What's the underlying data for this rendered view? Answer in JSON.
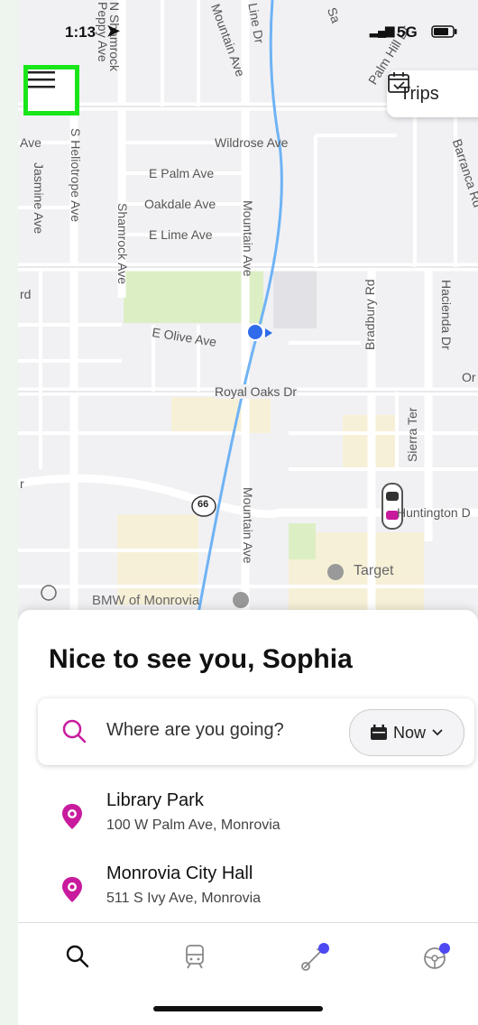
{
  "status": {
    "time": "1:13",
    "network": "5G"
  },
  "trips_label": "Trips",
  "map_labels": {
    "streets": [
      "Wildrose Ave",
      "E Palm Ave",
      "Oakdale Ave",
      "E Lime Ave",
      "E Olive Ave",
      "Royal Oaks Dr",
      "Mountain Ave",
      "Mountain Ave",
      "Shamrock Ave",
      "S Heliotrope Ave",
      "Jasmine Ave",
      "Bradbury Rd",
      "Hacienda Dr",
      "Sierra Ter",
      "Barranca Rd",
      "Palm Hill Dr",
      "Huntington D",
      "Peppy Ave",
      "N Shamrock",
      "Mountain Ave",
      "Line Dr",
      "Sa",
      "Ave",
      "rd",
      "r",
      "Or"
    ],
    "poi": [
      "Target",
      "BMW of Monrovia"
    ],
    "route_shield": "66"
  },
  "sheet": {
    "greeting": "Nice to see you, Sophia",
    "search_placeholder": "Where are you going?",
    "time_option": "Now"
  },
  "recent_places": [
    {
      "name": "Library Park",
      "address": "100 W Palm Ave, Monrovia"
    },
    {
      "name": "Monrovia City Hall",
      "address": "511 S Ivy Ave, Monrovia"
    }
  ],
  "tabs": [
    "search-icon",
    "transit-icon",
    "scooter-icon",
    "steering-wheel-icon"
  ],
  "colors": {
    "accent": "#c81b9d",
    "badge": "#4d49f2",
    "route": "#6fb3f5",
    "park": "#dcefc4",
    "commercial": "#f6f0d7"
  }
}
